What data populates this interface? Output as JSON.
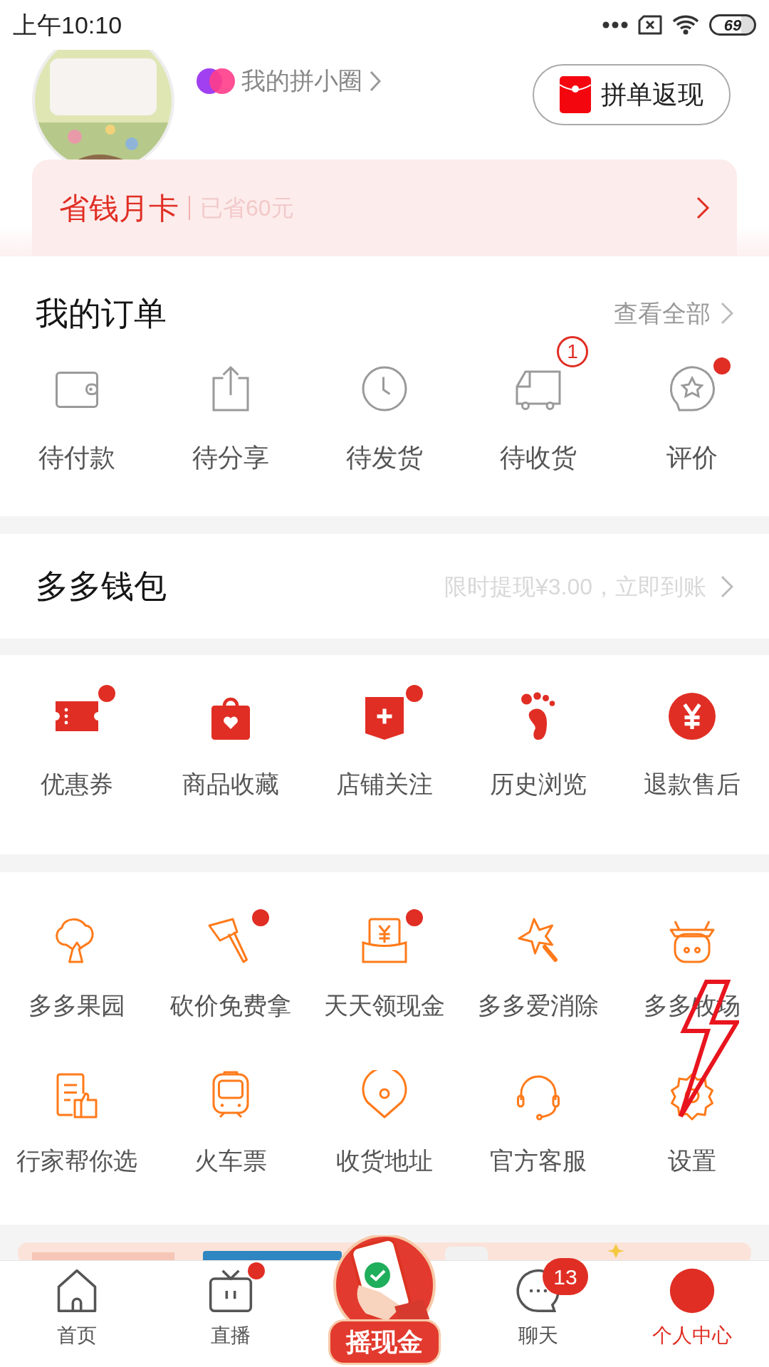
{
  "status_bar": {
    "time": "上午10:10",
    "battery": "69"
  },
  "profile": {
    "circle_link": "我的拼小圈",
    "cashback_button": "拼单返现"
  },
  "savings_card": {
    "title": "省钱月卡",
    "subtitle": "已省60元"
  },
  "orders": {
    "title": "我的订单",
    "view_all": "查看全部",
    "items": [
      {
        "kind": "wallet",
        "label": "待付款",
        "dot": false
      },
      {
        "kind": "share",
        "label": "待分享",
        "dot": false
      },
      {
        "kind": "clock",
        "label": "待发货",
        "dot": false
      },
      {
        "kind": "truck",
        "label": "待收货",
        "badge": "1",
        "dot": false
      },
      {
        "kind": "review",
        "label": "评价",
        "dot": true
      }
    ]
  },
  "wallet": {
    "title": "多多钱包",
    "promo": "限时提现¥3.00，立即到账"
  },
  "services": [
    {
      "kind": "coupon",
      "label": "优惠券",
      "dot": true
    },
    {
      "kind": "bag",
      "label": "商品收藏",
      "dot": false
    },
    {
      "kind": "shop",
      "label": "店铺关注",
      "dot": true
    },
    {
      "kind": "foot",
      "label": "历史浏览",
      "dot": false
    },
    {
      "kind": "yen",
      "label": "退款售后",
      "dot": false
    }
  ],
  "tools": [
    {
      "kind": "tree",
      "label": "多多果园",
      "dot": false
    },
    {
      "kind": "axe",
      "label": "砍价免费拿",
      "dot": true
    },
    {
      "kind": "envelope",
      "label": "天天领现金",
      "dot": true
    },
    {
      "kind": "wand",
      "label": "多多爱消除",
      "dot": false
    },
    {
      "kind": "cow",
      "label": "多多牧场",
      "dot": false
    },
    {
      "kind": "doc",
      "label": "行家帮你选",
      "dot": false
    },
    {
      "kind": "train",
      "label": "火车票",
      "dot": false
    },
    {
      "kind": "pin",
      "label": "收货地址",
      "dot": false
    },
    {
      "kind": "headset",
      "label": "官方客服",
      "dot": false
    },
    {
      "kind": "gear",
      "label": "设置",
      "dot": false
    }
  ],
  "bottom_nav": [
    {
      "kind": "home",
      "label": "首页",
      "selected": false,
      "dot": false
    },
    {
      "kind": "live",
      "label": "直播",
      "selected": false,
      "dot": true
    },
    {
      "kind": "shake",
      "label": "摇现金",
      "selected": false
    },
    {
      "kind": "chat",
      "label": "聊天",
      "selected": false,
      "dot": false,
      "badge": "13"
    },
    {
      "kind": "me",
      "label": "个人中心",
      "selected": true,
      "dot": false
    }
  ]
}
